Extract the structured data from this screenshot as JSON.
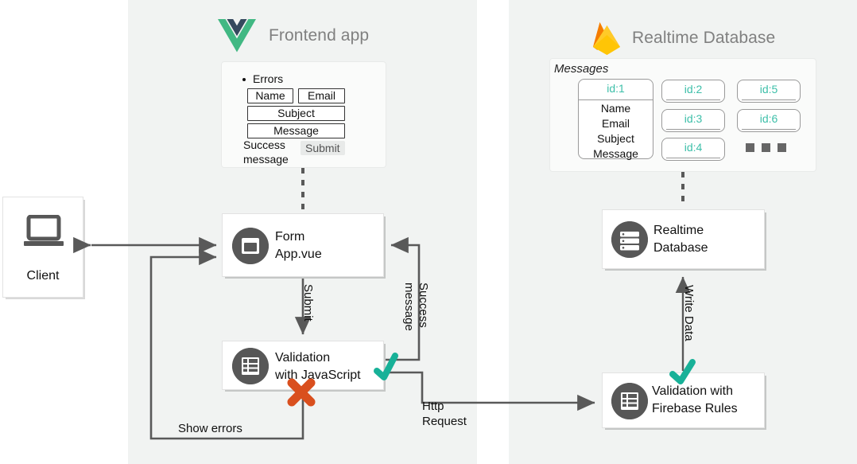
{
  "panels": {
    "frontend": {
      "title": "Frontend app",
      "logo": "vue-logo"
    },
    "database": {
      "title": "Realtime Database",
      "logo": "firebase-logo"
    }
  },
  "form_card": {
    "errors_label": "Errors",
    "fields": [
      {
        "name": "name-field",
        "label": "Name"
      },
      {
        "name": "email-field",
        "label": "Email"
      },
      {
        "name": "subject-field",
        "label": "Subject"
      },
      {
        "name": "message-field",
        "label": "Message"
      }
    ],
    "success_message": "Success\nmessage",
    "submit_label": "Submit"
  },
  "messages_card": {
    "label": "Messages",
    "record_primary": {
      "id": "id:1",
      "fields": "Name\nEmail\nSubject\nMessage"
    },
    "records": [
      {
        "id": "id:2"
      },
      {
        "id": "id:3"
      },
      {
        "id": "id:4"
      },
      {
        "id": "id:5"
      },
      {
        "id": "id:6"
      }
    ],
    "ellipsis": "•••"
  },
  "nodes": {
    "client": {
      "label": "Client",
      "icon": "laptop-icon"
    },
    "form": {
      "label": "Form\nApp.vue",
      "icon": "window-icon"
    },
    "validation_js": {
      "label": "Validation\nwith JavaScript",
      "icon": "list-icon"
    },
    "rtdb": {
      "label": "Realtime\nDatabase",
      "icon": "database-icon"
    },
    "validation_rules": {
      "label": "Validation with\nFirebase Rules",
      "icon": "list-icon"
    }
  },
  "edges": {
    "submit": "Submit",
    "success_message": "Success\nmessage",
    "show_errors": "Show errors",
    "http_request": "Http\nRequest",
    "write_data": "Write Data"
  },
  "markers": {
    "check_js": "check-mark",
    "cross_js": "cross-mark",
    "check_rules": "check-mark"
  },
  "colors": {
    "panel_bg": "#f1f3f2",
    "page_bg": "#ffffff",
    "header_text": "#808080",
    "node_icon": "#575757",
    "arrow": "#595959",
    "accent_teal": "#3dbfa9",
    "check_green": "#18b198",
    "cross_red": "#d94f1e",
    "vue_green": "#41b883",
    "vue_navy": "#35495e",
    "firebase_yellow": "#ffc400",
    "firebase_orange": "#ffa000",
    "firebase_amber": "#f57c00"
  }
}
